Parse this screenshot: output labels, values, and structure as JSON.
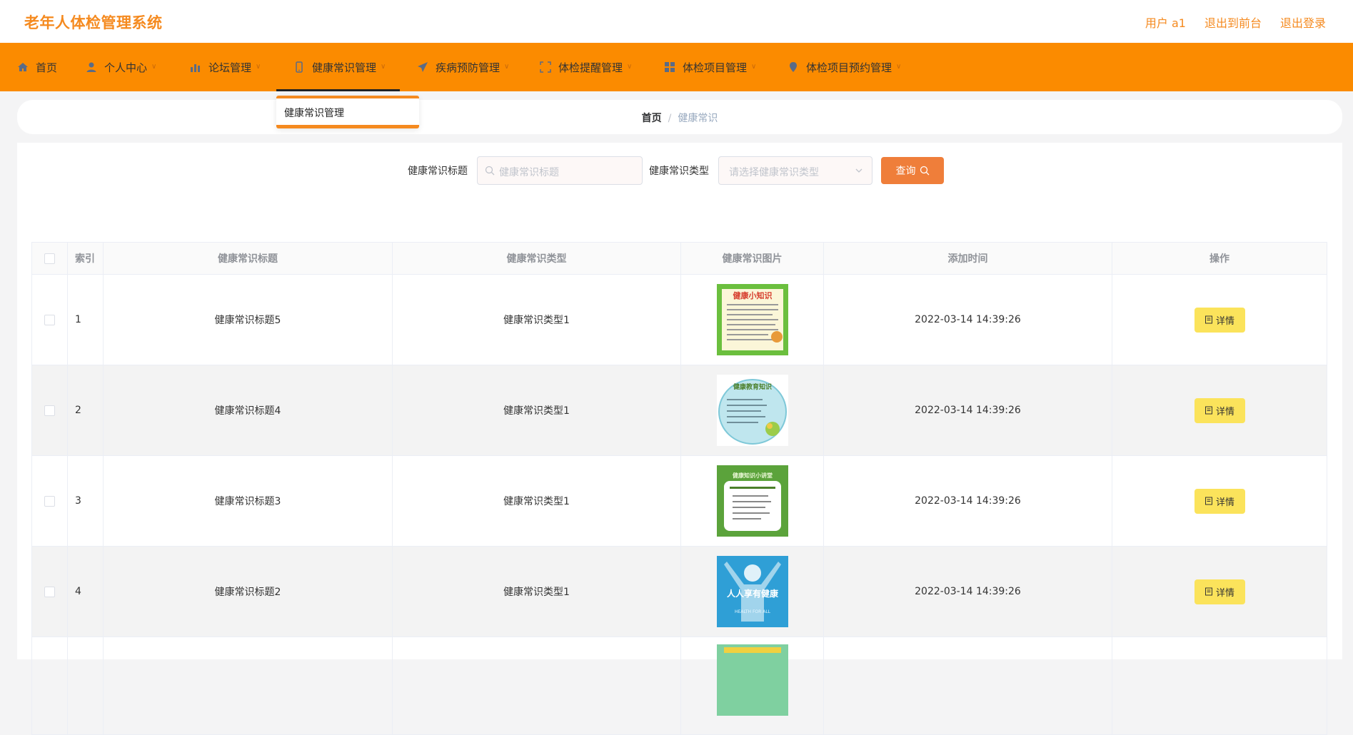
{
  "header": {
    "title": "老年人体检管理系统",
    "user": "用户 a1",
    "to_front": "退出到前台",
    "logout": "退出登录"
  },
  "nav": [
    {
      "label": "首页",
      "icon": "home-icon"
    },
    {
      "label": "个人中心",
      "icon": "user-icon"
    },
    {
      "label": "论坛管理",
      "icon": "chart-icon"
    },
    {
      "label": "健康常识管理",
      "icon": "phone-icon"
    },
    {
      "label": "疾病预防管理",
      "icon": "send-icon"
    },
    {
      "label": "体检提醒管理",
      "icon": "frame-icon"
    },
    {
      "label": "体检项目管理",
      "icon": "grid-icon"
    },
    {
      "label": "体检项目预约管理",
      "icon": "location-icon"
    }
  ],
  "dropdown": {
    "item": "健康常识管理"
  },
  "breadcrumb": {
    "home": "首页",
    "sep": "/",
    "current": "健康常识"
  },
  "search": {
    "title_label": "健康常识标题",
    "title_placeholder": "健康常识标题",
    "type_label": "健康常识类型",
    "type_placeholder": "请选择健康常识类型",
    "query_label": "查询"
  },
  "table": {
    "headers": [
      "索引",
      "健康常识标题",
      "健康常识类型",
      "健康常识图片",
      "添加时间",
      "操作"
    ],
    "rows": [
      {
        "index": "1",
        "title": "健康常识标题5",
        "type": "健康常识类型1",
        "time": "2022-03-14 14:39:26",
        "action": "详情"
      },
      {
        "index": "2",
        "title": "健康常识标题4",
        "type": "健康常识类型1",
        "time": "2022-03-14 14:39:26",
        "action": "详情"
      },
      {
        "index": "3",
        "title": "健康常识标题3",
        "type": "健康常识类型1",
        "time": "2022-03-14 14:39:26",
        "action": "详情"
      },
      {
        "index": "4",
        "title": "健康常识标题2",
        "type": "健康常识类型1",
        "time": "2022-03-14 14:39:26",
        "action": "详情"
      }
    ],
    "images": [
      {
        "heading": "健康小知识"
      },
      {
        "heading": "健康教育知识"
      },
      {
        "heading": "健康知识小讲堂"
      },
      {
        "heading": "人人享有健康",
        "sub": "HEALTH FOR ALL"
      }
    ]
  },
  "colors": {
    "accent": "#fb8b00",
    "title": "#f58a1f",
    "query": "#ef7e3a",
    "detail": "#fbe35b"
  }
}
